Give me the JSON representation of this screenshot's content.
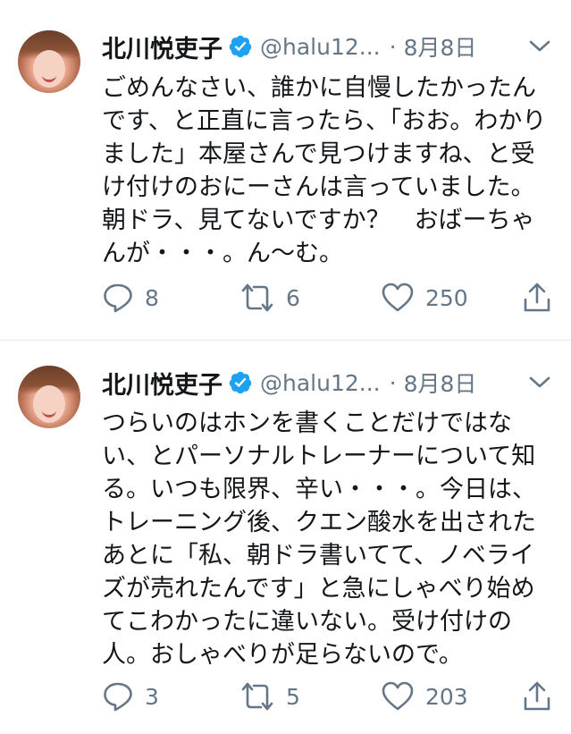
{
  "tweets": [
    {
      "author_name": "北川悦吏子",
      "handle": "@halu12...",
      "separator": "·",
      "date": "8月8日",
      "text": "ごめんなさい、誰かに自慢したかったんです、と正直に言ったら、「おお。わかりました」本屋さんで見つけますね、と受け付けのおにーさんは言っていました。朝ドラ、見てないですか？　おばーちゃんが・・・。ん〜む。",
      "replies": "8",
      "retweets": "6",
      "likes": "250"
    },
    {
      "author_name": "北川悦吏子",
      "handle": "@halu12...",
      "separator": "·",
      "date": "8月8日",
      "text": "つらいのはホンを書くことだけではない、とパーソナルトレーナーについて知る。いつも限界、辛い・・・。今日は、トレーニング後、クエン酸水を出されたあとに「私、朝ドラ書いてて、ノベライズが売れたんです」と急にしゃべり始めてこわかったに違いない。受け付けの人。おしゃべりが足らないので。",
      "replies": "3",
      "retweets": "5",
      "likes": "203"
    }
  ],
  "icons": {
    "verified": "verified-badge-icon",
    "menu": "chevron-down-icon",
    "reply": "reply-icon",
    "retweet": "retweet-icon",
    "like": "heart-icon",
    "share": "share-icon"
  },
  "colors": {
    "verified_blue": "#1da1f2",
    "text": "#14171a",
    "secondary": "#657786",
    "divider": "#e6ecf0"
  }
}
